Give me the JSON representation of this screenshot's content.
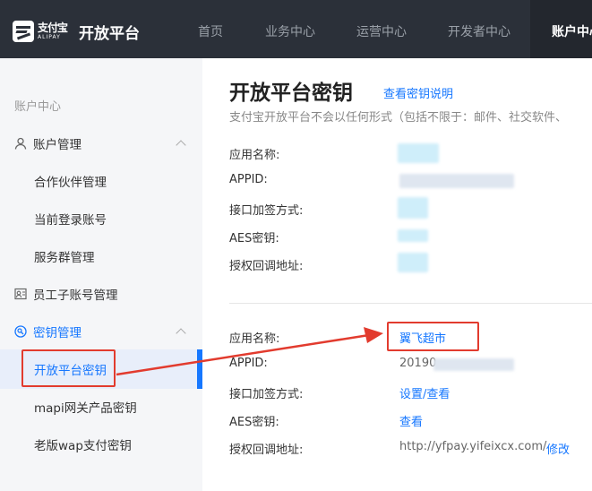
{
  "header": {
    "logo_cn": "支付宝",
    "logo_en": "ALIPAY",
    "brand_title": "开放平台",
    "nav": [
      "首页",
      "业务中心",
      "运营中心",
      "开发者中心",
      "账户中心"
    ]
  },
  "sidebar": {
    "section_title": "账户中心",
    "account_group": "账户管理",
    "account_items": [
      "合作伙伴管理",
      "当前登录账号",
      "服务群管理"
    ],
    "employee_item": "员工子账号管理",
    "key_group": "密钥管理",
    "key_items": [
      "开放平台密钥",
      "mapi网关产品密钥",
      "老版wap支付密钥"
    ]
  },
  "main": {
    "title": "开放平台密钥",
    "doc_link": "查看密钥说明",
    "subtitle": "支付宝开放平台不会以任何形式（包括不限于：邮件、社交软件、",
    "labels": [
      "应用名称:",
      "APPID:",
      "接口加签方式:",
      "AES密钥:",
      "授权回调地址:"
    ],
    "app2": {
      "name": "翼飞超市",
      "appid_prefix": "20190",
      "sign_link": "设置/查看",
      "aes_link": "查看",
      "callback_url": "http://yfpay.yifeixcx.com/",
      "edit_link": "修改"
    }
  },
  "colors": {
    "accent": "#1677ff",
    "annotation_red": "#e23b2e",
    "header_bg": "#2b3039"
  }
}
